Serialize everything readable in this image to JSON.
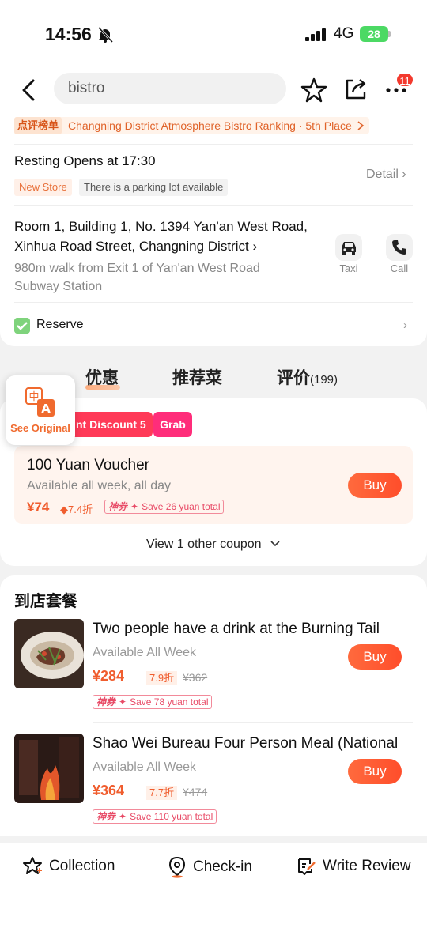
{
  "status": {
    "time": "14:56",
    "network": "4G",
    "battery": "28"
  },
  "header": {
    "search_value": "bistro",
    "notification_count": "11"
  },
  "ranking": {
    "tag": "点评榜单",
    "text": "Changning District Atmosphere Bistro Ranking · 5th Place"
  },
  "info": {
    "hours": "Resting  Opens at 17:30",
    "tags": [
      "New Store",
      "There is a parking lot available"
    ],
    "detail": "Detail",
    "address": "Room 1, Building 1, No. 1394 Yan'an West Road, Xinhua Road Street, Changning District",
    "walk": "980m walk from Exit 1 of Yan'an West Road Subway Station",
    "taxi": "Taxi",
    "call": "Call",
    "reserve": "Reserve"
  },
  "tabs": [
    {
      "label": "优惠"
    },
    {
      "label": "推荐菜"
    },
    {
      "label": "评价",
      "count": "(199)"
    }
  ],
  "translate": {
    "label": "See Original"
  },
  "coupon": {
    "promo": "nt Discount 5",
    "grab": "Grab",
    "title": "100 Yuan Voucher",
    "sub": "Available all week, all day",
    "price": "¥74",
    "discount": "7.4折",
    "save_brand": "神券",
    "save_text": "Save 26 yuan total",
    "buy": "Buy",
    "view_more": "View 1 other coupon"
  },
  "packages": {
    "title": "到店套餐",
    "items": [
      {
        "title": "Two people have a drink at the Burning Tail",
        "sub": "Available All Week",
        "price": "¥284",
        "discount": "7.9折",
        "original": "¥362",
        "save_brand": "神券",
        "save_text": "Save 78 yuan total",
        "buy": "Buy"
      },
      {
        "title": "Shao Wei Bureau Four Person Meal (National",
        "sub": "Available All Week",
        "price": "¥364",
        "discount": "7.7折",
        "original": "¥474",
        "save_brand": "神券",
        "save_text": "Save 110 yuan total",
        "buy": "Buy"
      }
    ]
  },
  "bottom_bar": {
    "collection": "Collection",
    "checkin": "Check-in",
    "review": "Write Review"
  }
}
